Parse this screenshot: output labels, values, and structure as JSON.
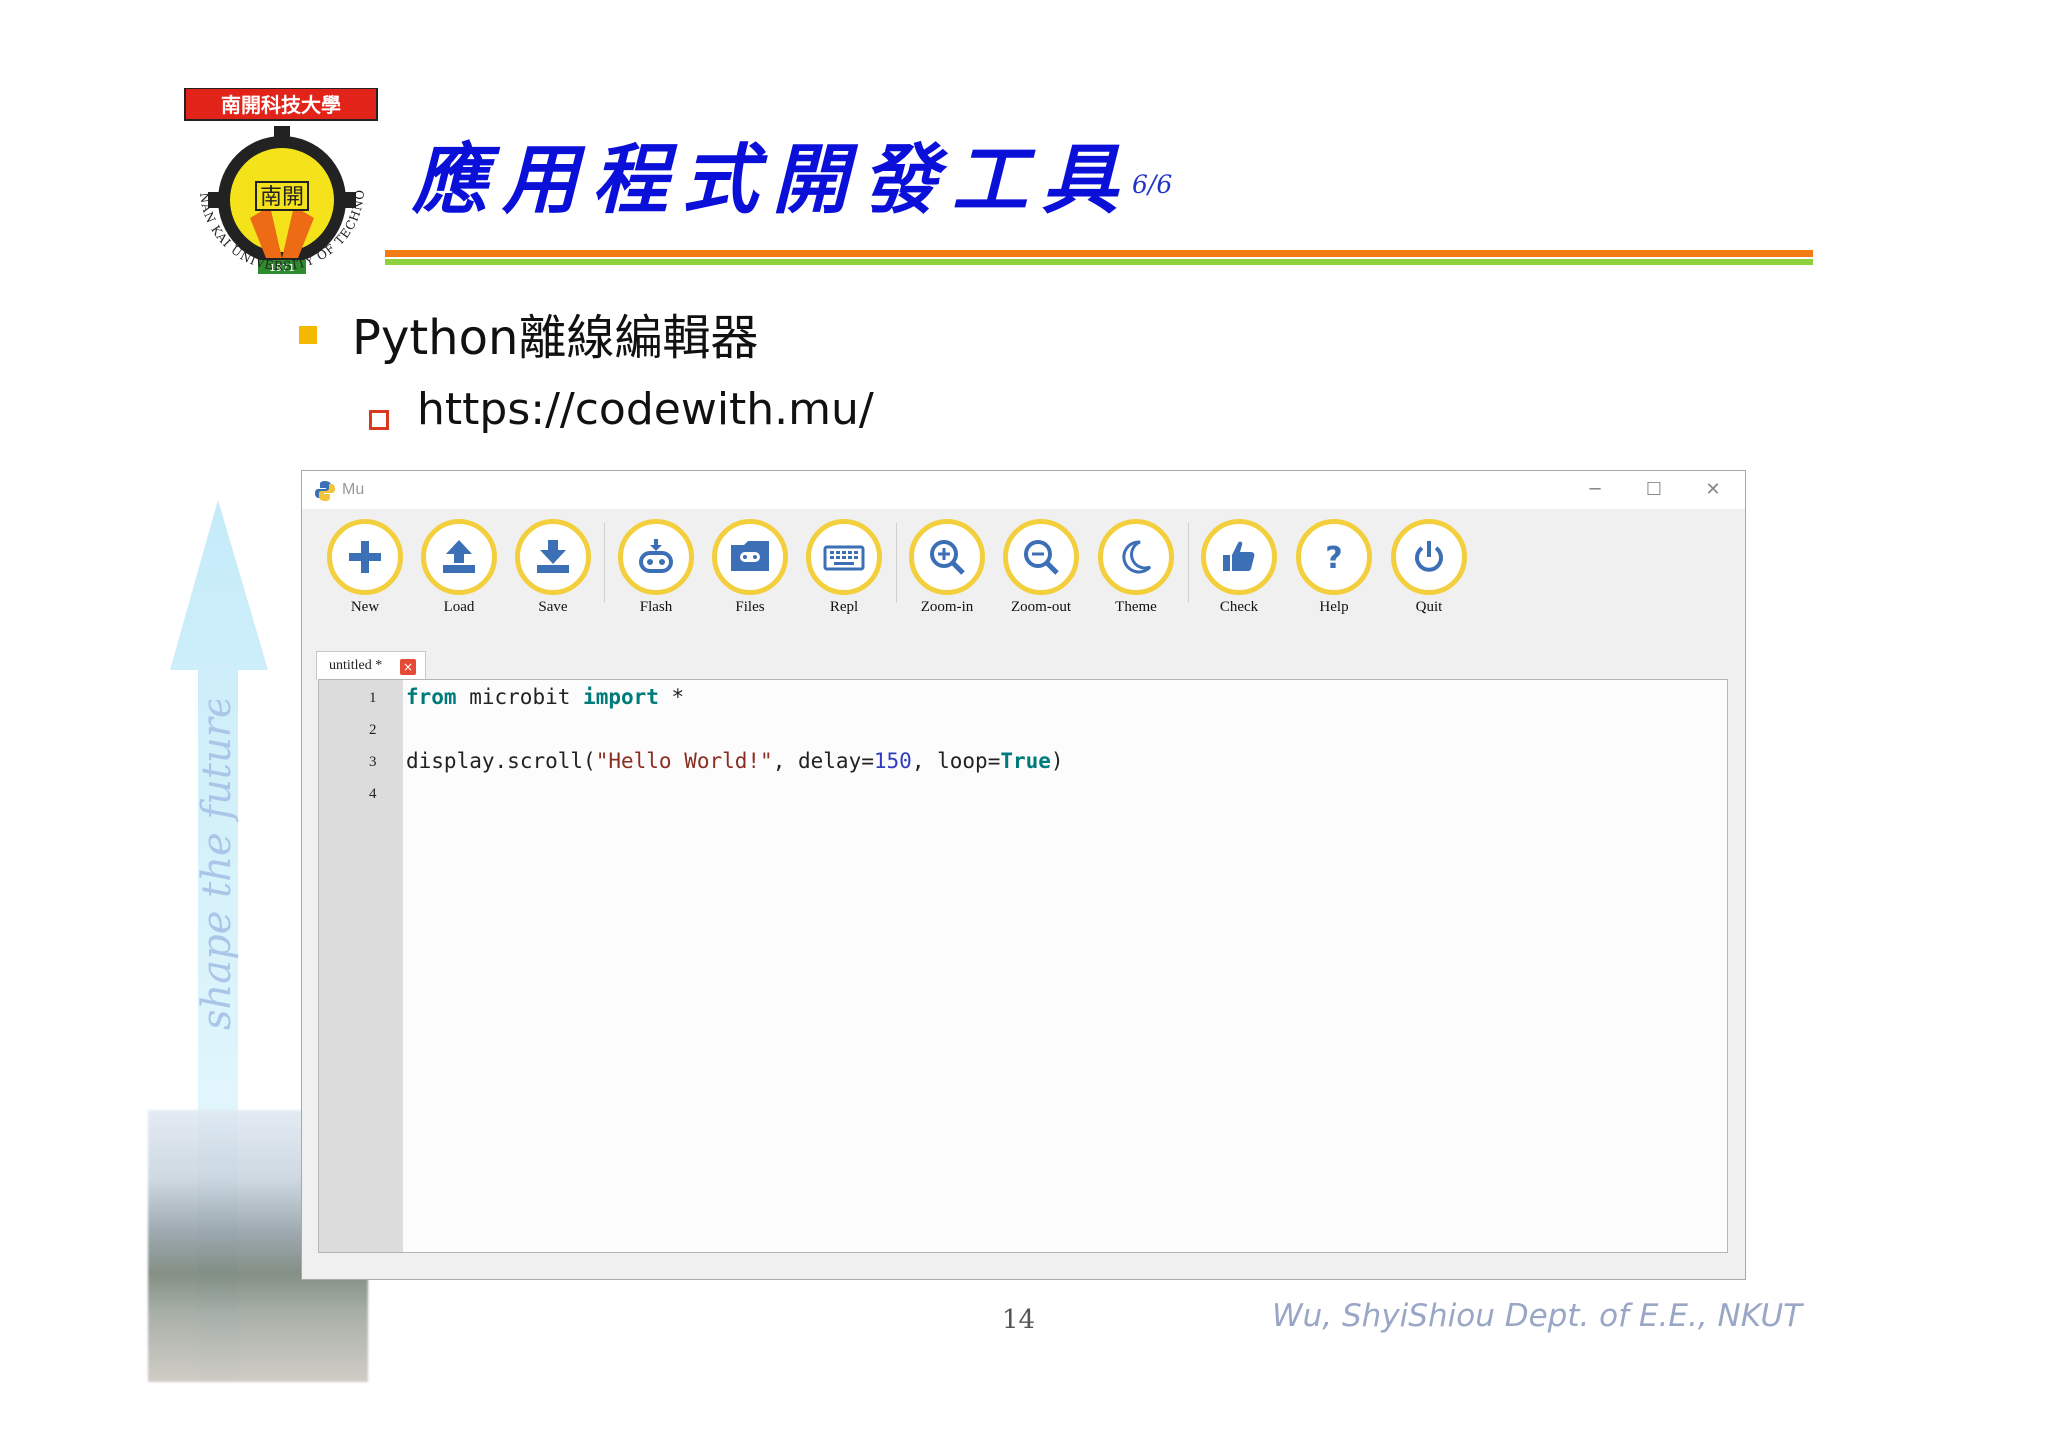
{
  "header": {
    "title": "應用程式開發工具",
    "page_index": "6/6",
    "logo_text": {
      "banner": "南開科技大學",
      "emblem": "南開",
      "year": "1971",
      "ring": "NAN KAI UNIVERSITY OF TECHNOLOGY"
    }
  },
  "sidebar": {
    "slogan": "shape the future"
  },
  "bullets": [
    {
      "text": "Python離線編輯器",
      "level": 1
    },
    {
      "text": "https://codewith.mu/",
      "level": 2
    }
  ],
  "mu_window": {
    "title": "Mu",
    "controls": {
      "minimize": "─",
      "maximize": "☐",
      "close": "✕"
    },
    "toolbar": [
      {
        "label": "New",
        "icon": "plus-icon"
      },
      {
        "label": "Load",
        "icon": "upload-icon"
      },
      {
        "label": "Save",
        "icon": "download-icon"
      },
      {
        "label": "Flash",
        "icon": "flash-icon"
      },
      {
        "label": "Files",
        "icon": "files-icon"
      },
      {
        "label": "Repl",
        "icon": "keyboard-icon"
      },
      {
        "label": "Zoom-in",
        "icon": "zoom-in-icon"
      },
      {
        "label": "Zoom-out",
        "icon": "zoom-out-icon"
      },
      {
        "label": "Theme",
        "icon": "moon-icon"
      },
      {
        "label": "Check",
        "icon": "thumbs-up-icon"
      },
      {
        "label": "Help",
        "icon": "help-icon"
      },
      {
        "label": "Quit",
        "icon": "power-icon"
      }
    ],
    "tab": {
      "label": "untitled *",
      "close_glyph": "×"
    },
    "editor": {
      "line_numbers": [
        "1",
        "2",
        "3",
        "4"
      ],
      "lines": [
        "from microbit import *",
        "",
        "display.scroll(\"Hello World!\", delay=150, loop=True)",
        ""
      ]
    },
    "colors": {
      "button_ring": "#f3cf3d",
      "button_icon": "#3b6fb6",
      "keyword": "#007b7b",
      "string": "#8b2e22",
      "number": "#2f3dbd"
    }
  },
  "footer": {
    "page_number": "14",
    "author": "Wu, ShyiShiou  Dept. of E.E., NKUT"
  },
  "colors": {
    "title": "#0a10d8",
    "rule_orange": "#f27b13",
    "rule_green": "#8fd13c",
    "bullet1": "#f5b800",
    "bullet2": "#d93a1e"
  }
}
